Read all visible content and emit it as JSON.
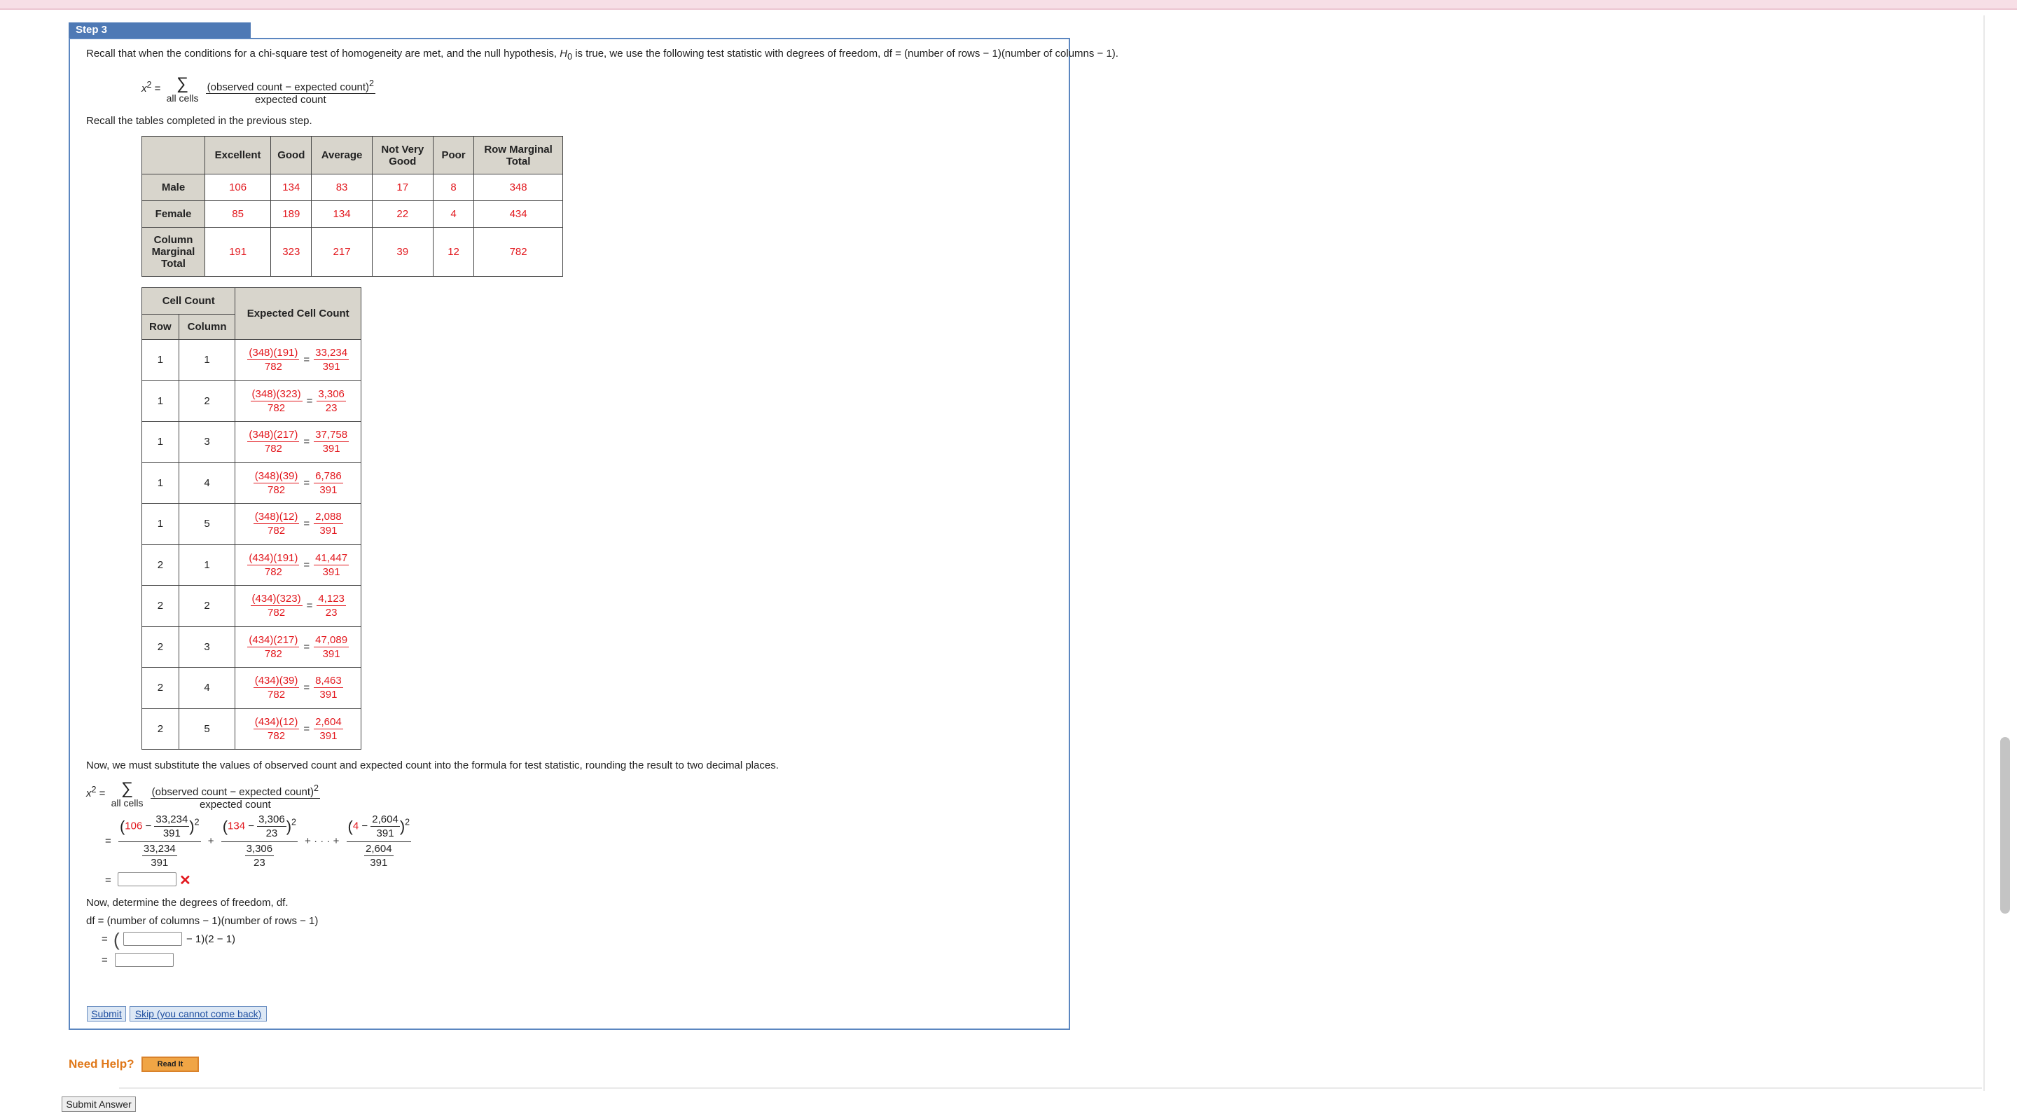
{
  "step_label": "Step 3",
  "intro_text_pre": "Recall that when the conditions for a chi-square test of homogeneity are met, and the null hypothesis,",
  "intro_h0": "H",
  "intro_h0_sub": "0",
  "intro_text_post": "is true, we use the following test statistic with degrees of freedom, df = (number of rows − 1)(number of columns − 1).",
  "formula": {
    "lhs": "x",
    "lhs_sup": "2",
    "equals": "=",
    "sigma": "∑",
    "sigma_sub": "all cells",
    "numerator": "(observed count − expected count)",
    "numerator_sup": "2",
    "denominator": "expected count"
  },
  "recall_tables_text": "Recall the tables completed in the previous step.",
  "observed_table": {
    "columns": [
      "Excellent",
      "Good",
      "Average",
      "Not Very Good",
      "Poor",
      "Row Marginal Total"
    ],
    "rows": [
      {
        "label": "Male",
        "values": [
          "106",
          "134",
          "83",
          "17",
          "8",
          "348"
        ]
      },
      {
        "label": "Female",
        "values": [
          "85",
          "189",
          "134",
          "22",
          "4",
          "434"
        ]
      },
      {
        "label": "Column Marginal Total",
        "values": [
          "191",
          "323",
          "217",
          "39",
          "12",
          "782"
        ]
      }
    ]
  },
  "expected_table": {
    "group_header": "Cell Count",
    "col_row": "Row",
    "col_column": "Column",
    "col_expected": "Expected Cell Count",
    "rows": [
      {
        "row": "1",
        "col": "1",
        "num": "(348)(191)",
        "den": "782",
        "rnum": "33,234",
        "rden": "391"
      },
      {
        "row": "1",
        "col": "2",
        "num": "(348)(323)",
        "den": "782",
        "rnum": "3,306",
        "rden": "23"
      },
      {
        "row": "1",
        "col": "3",
        "num": "(348)(217)",
        "den": "782",
        "rnum": "37,758",
        "rden": "391"
      },
      {
        "row": "1",
        "col": "4",
        "num": "(348)(39)",
        "den": "782",
        "rnum": "6,786",
        "rden": "391"
      },
      {
        "row": "1",
        "col": "5",
        "num": "(348)(12)",
        "den": "782",
        "rnum": "2,088",
        "rden": "391"
      },
      {
        "row": "2",
        "col": "1",
        "num": "(434)(191)",
        "den": "782",
        "rnum": "41,447",
        "rden": "391"
      },
      {
        "row": "2",
        "col": "2",
        "num": "(434)(323)",
        "den": "782",
        "rnum": "4,123",
        "rden": "23"
      },
      {
        "row": "2",
        "col": "3",
        "num": "(434)(217)",
        "den": "782",
        "rnum": "47,089",
        "rden": "391"
      },
      {
        "row": "2",
        "col": "4",
        "num": "(434)(39)",
        "den": "782",
        "rnum": "8,463",
        "rden": "391"
      },
      {
        "row": "2",
        "col": "5",
        "num": "(434)(12)",
        "den": "782",
        "rnum": "2,604",
        "rden": "391"
      }
    ]
  },
  "substitute_text": "Now, we must substitute the values of observed count and expected count into the formula for test statistic, rounding the result to two decimal places.",
  "substitution": {
    "t1_obs": "106",
    "t1_exp_num": "33,234",
    "t1_exp_den": "391",
    "t2_obs": "134",
    "t2_exp_num": "3,306",
    "t2_exp_den": "23",
    "t3_obs": "4",
    "t3_exp_num": "2,604",
    "t3_exp_den": "391",
    "minus": "−",
    "plus": "+",
    "dots": "+ · · · +",
    "sup2": "2"
  },
  "df_text": "Now, determine the degrees of freedom, df.",
  "df_formula": "df  =  (number of columns − 1)(number of rows − 1)",
  "df_step_suffix": "− 1)(2 − 1)",
  "buttons": {
    "submit": "Submit",
    "skip": "Skip (you cannot come back)",
    "read_it": "Read It",
    "submit_answer": "Submit Answer"
  },
  "need_help": "Need Help?",
  "x_mark": "✕",
  "colors": {
    "accent_blue": "#4e79b5",
    "answer_red": "#e2181e",
    "help_orange": "#e0791b"
  }
}
